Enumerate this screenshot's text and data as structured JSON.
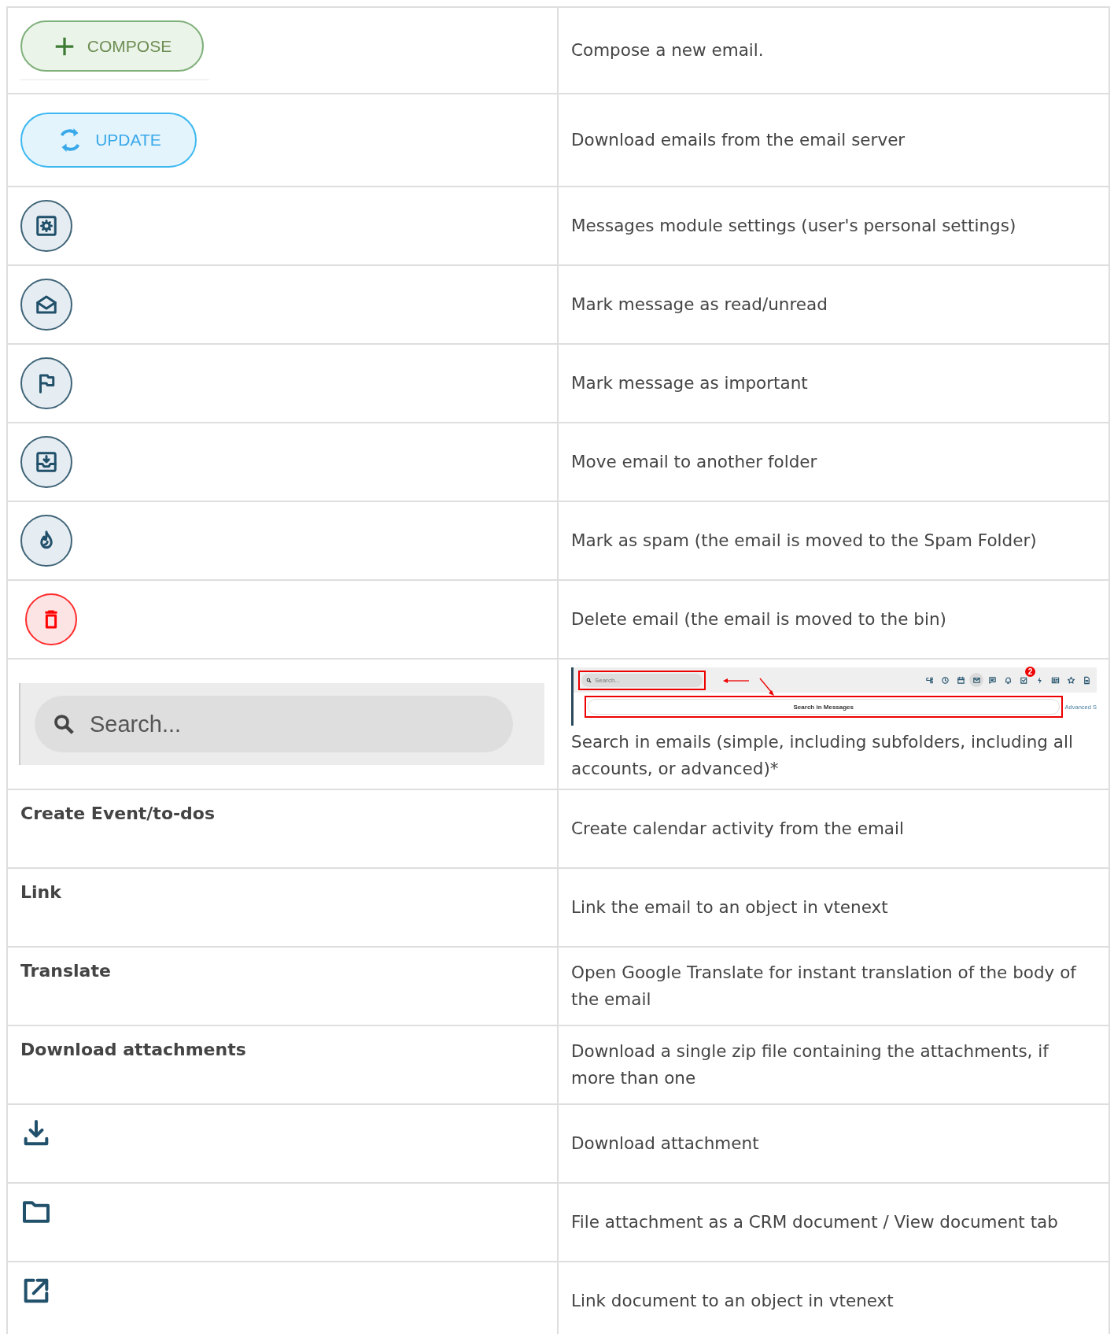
{
  "rows": [
    {
      "left": {
        "kind": "compose_button",
        "label": "COMPOSE"
      },
      "text": "Compose a new email."
    },
    {
      "left": {
        "kind": "update_button",
        "label": "UPDATE"
      },
      "text": "Download emails from the email server"
    },
    {
      "left": {
        "kind": "round_button"
      },
      "text": "Messages module settings (user's personal settings)"
    },
    {
      "left": {
        "kind": "round_button"
      },
      "text": "Mark message as read/unread"
    },
    {
      "left": {
        "kind": "round_button"
      },
      "text": "Mark message as important"
    },
    {
      "left": {
        "kind": "round_button"
      },
      "text": "Move email to another folder"
    },
    {
      "left": {
        "kind": "round_button"
      },
      "text": "Mark as spam (the email is moved to the Spam Folder)"
    },
    {
      "left": {
        "kind": "delete_button"
      },
      "text": "Delete email (the email is moved to the bin)"
    },
    {
      "left": {
        "kind": "search_field",
        "placeholder": "Search..."
      },
      "screenshot": {
        "search_placeholder": "Search...",
        "badge": "2",
        "bar_label": "Search in Messages",
        "side_link": "Advanced S"
      },
      "text": "Search in emails (simple, including subfolders, including all accounts, or advanced)*"
    },
    {
      "left": {
        "kind": "label",
        "text": "Create Event/to-dos"
      },
      "text": "Create calendar activity from the email"
    },
    {
      "left": {
        "kind": "label",
        "text": "Link"
      },
      "text": "Link the email to an object in vtenext"
    },
    {
      "left": {
        "kind": "label",
        "text": "Translate"
      },
      "text": "Open Google Translate for instant translation of the body of the email"
    },
    {
      "left": {
        "kind": "label",
        "text": "Download attachments"
      },
      "text": "Download a single zip file containing the attachments, if more than one"
    },
    {
      "left": {
        "kind": "icon"
      },
      "text": "Download attachment"
    },
    {
      "left": {
        "kind": "icon"
      },
      "text": "File attachment as a CRM document / View document tab"
    },
    {
      "left": {
        "kind": "icon"
      },
      "text": "Link document to an object in vtenext"
    }
  ]
}
